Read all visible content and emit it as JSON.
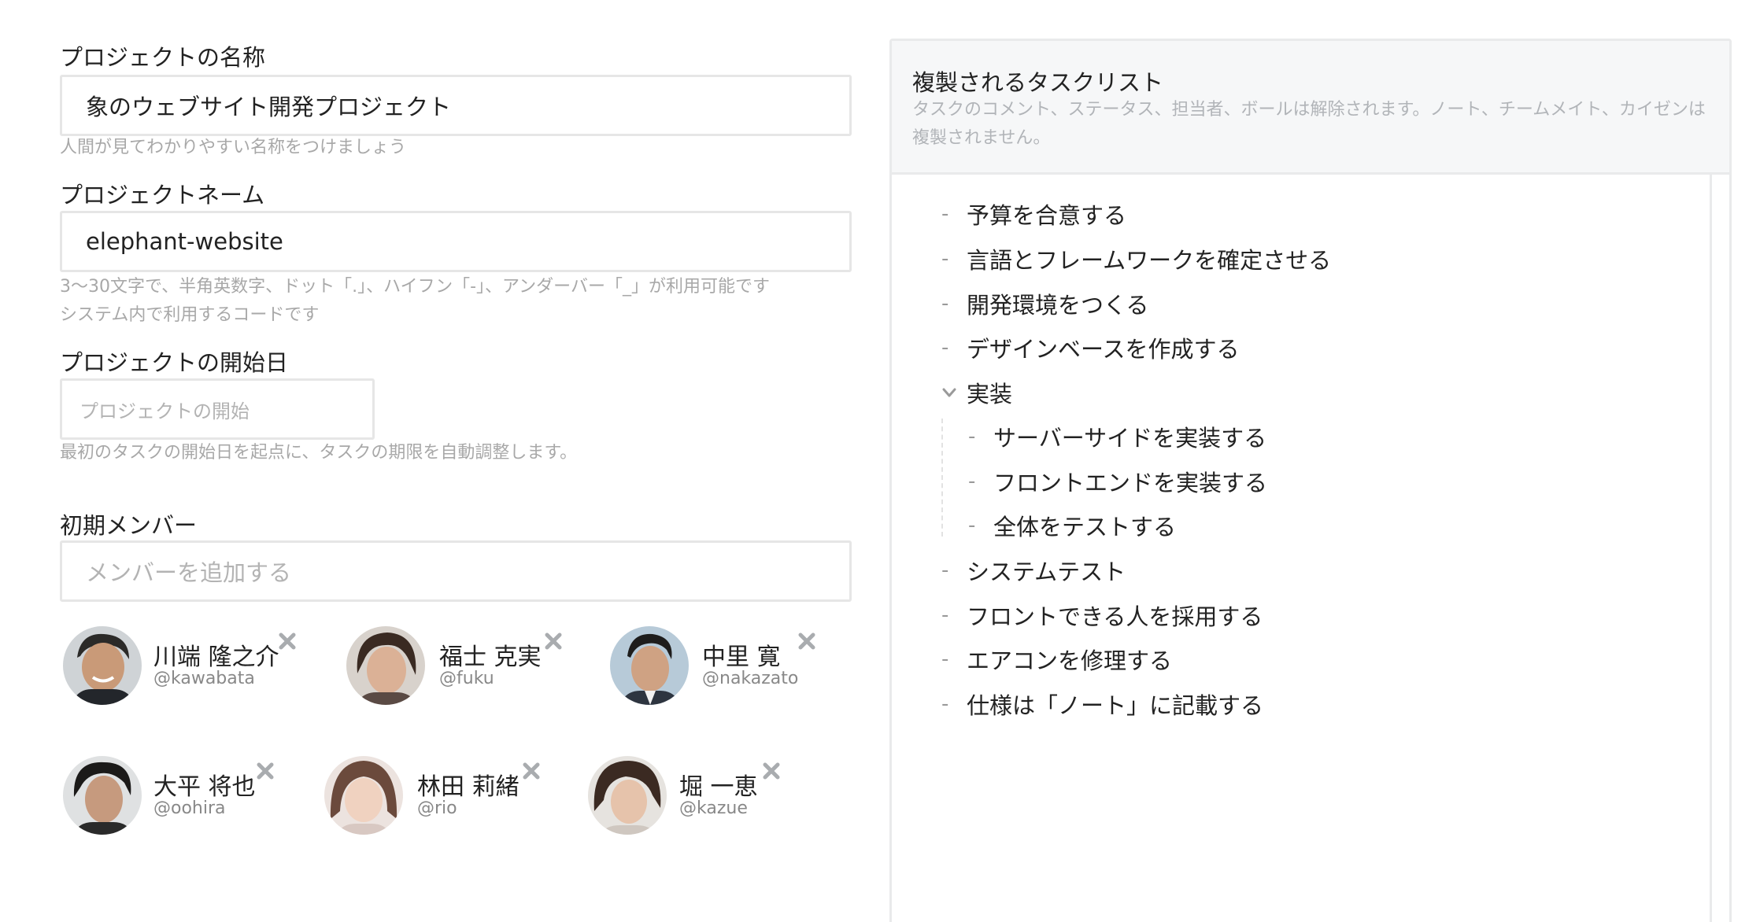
{
  "form": {
    "project_name": {
      "label": "プロジェクトの名称",
      "value": "象のウェブサイト開発プロジェクト",
      "hint": "人間が見てわかりやすい名称をつけましょう"
    },
    "project_code": {
      "label": "プロジェクトネーム",
      "value": "elephant-website",
      "hint_line1": "3〜30文字で、半角英数字、ドット「.」、ハイフン「-」、アンダーバー「_」が利用可能です",
      "hint_line2": "システム内で利用するコードです"
    },
    "start_date": {
      "label": "プロジェクトの開始日",
      "placeholder": "プロジェクトの開始",
      "hint": "最初のタスクの開始日を起点に、タスクの期限を自動調整します。"
    },
    "members": {
      "label": "初期メンバー",
      "placeholder": "メンバーを追加する",
      "list": [
        {
          "name": "川端 隆之介",
          "handle": "@kawabata"
        },
        {
          "name": "福士 克実",
          "handle": "@fuku"
        },
        {
          "name": "中里 寛",
          "handle": "@nakazato"
        },
        {
          "name": "大平 将也",
          "handle": "@oohira"
        },
        {
          "name": "林田 莉緒",
          "handle": "@rio"
        },
        {
          "name": "堀 一恵",
          "handle": "@kazue"
        }
      ]
    }
  },
  "tasklist": {
    "title": "複製されるタスクリスト",
    "description": "タスクのコメント、ステータス、担当者、ボールは解除されます。ノート、チームメイト、カイゼンは複製されません。",
    "items": [
      {
        "label": "予算を合意する",
        "level": 0
      },
      {
        "label": "言語とフレームワークを確定させる",
        "level": 0
      },
      {
        "label": "開発環境をつくる",
        "level": 0
      },
      {
        "label": "デザインベースを作成する",
        "level": 0
      },
      {
        "label": "実装",
        "level": 0,
        "expanded": true
      },
      {
        "label": "サーバーサイドを実装する",
        "level": 1
      },
      {
        "label": "フロントエンドを実装する",
        "level": 1
      },
      {
        "label": "全体をテストする",
        "level": 1
      },
      {
        "label": "システムテスト",
        "level": 0
      },
      {
        "label": "フロントできる人を採用する",
        "level": 0
      },
      {
        "label": "エアコンを修理する",
        "level": 0
      },
      {
        "label": "仕様は「ノート」に記載する",
        "level": 0
      }
    ]
  },
  "colors": {
    "border": "#e6e6e6",
    "hint_text": "#a8a8a8",
    "panel_header_bg": "#f6f7f8",
    "remove_icon": "#a9acaf"
  },
  "icons": {
    "remove": "close-icon",
    "expand": "chevron-down-icon",
    "bullet": "dash"
  }
}
